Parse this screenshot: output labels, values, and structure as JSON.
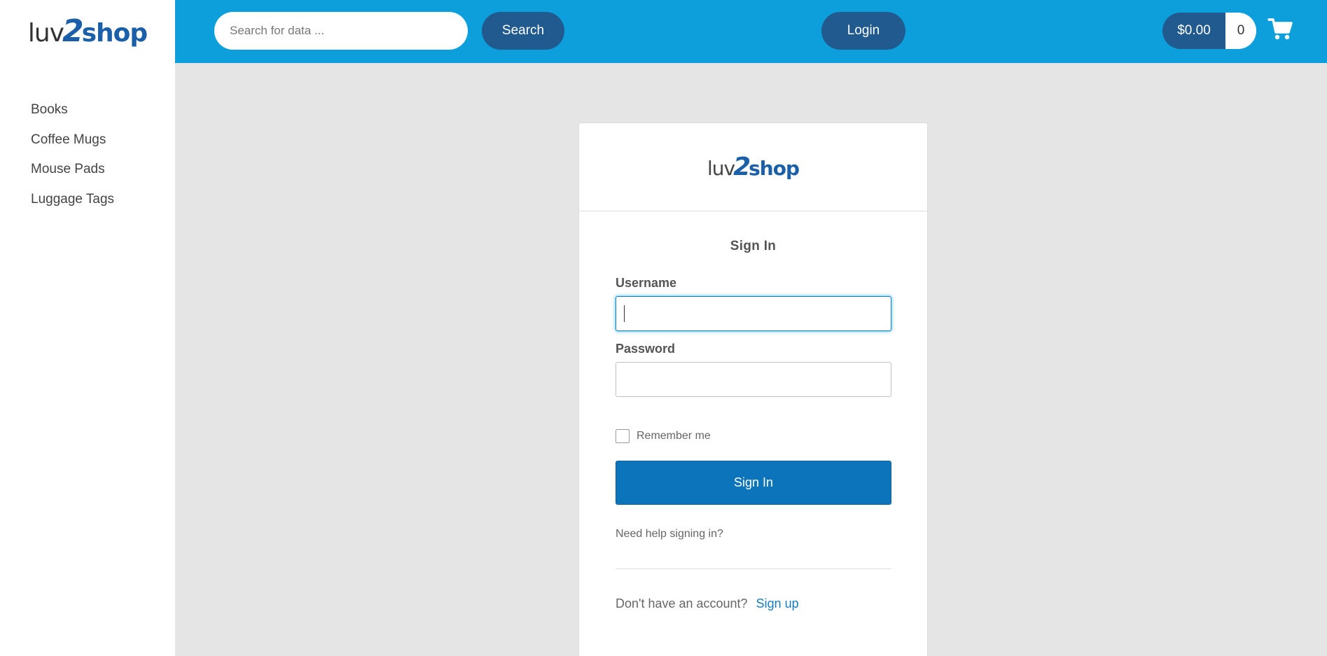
{
  "brand": {
    "logo_luv": "luv",
    "logo_two": "2",
    "logo_shop": "shop"
  },
  "sidebar": {
    "items": [
      {
        "label": "Books"
      },
      {
        "label": "Coffee Mugs"
      },
      {
        "label": "Mouse Pads"
      },
      {
        "label": "Luggage Tags"
      }
    ]
  },
  "header": {
    "search_placeholder": "Search for data ...",
    "search_value": "",
    "search_button": "Search",
    "login_button": "Login",
    "cart_total": "$0.00",
    "cart_count": "0",
    "cart_icon": "shopping-cart-icon"
  },
  "login_card": {
    "title": "Sign In",
    "username_label": "Username",
    "username_value": "",
    "password_label": "Password",
    "password_value": "",
    "remember_label": "Remember me",
    "remember_checked": false,
    "submit_label": "Sign In",
    "help_link": "Need help signing in?",
    "signup_prompt": "Don't have an account?",
    "signup_link": "Sign up"
  },
  "colors": {
    "header_bg": "#0d9fdc",
    "pill_button": "#205a8e",
    "primary_button": "#0b74bb",
    "page_bg": "#e5e5e5"
  }
}
